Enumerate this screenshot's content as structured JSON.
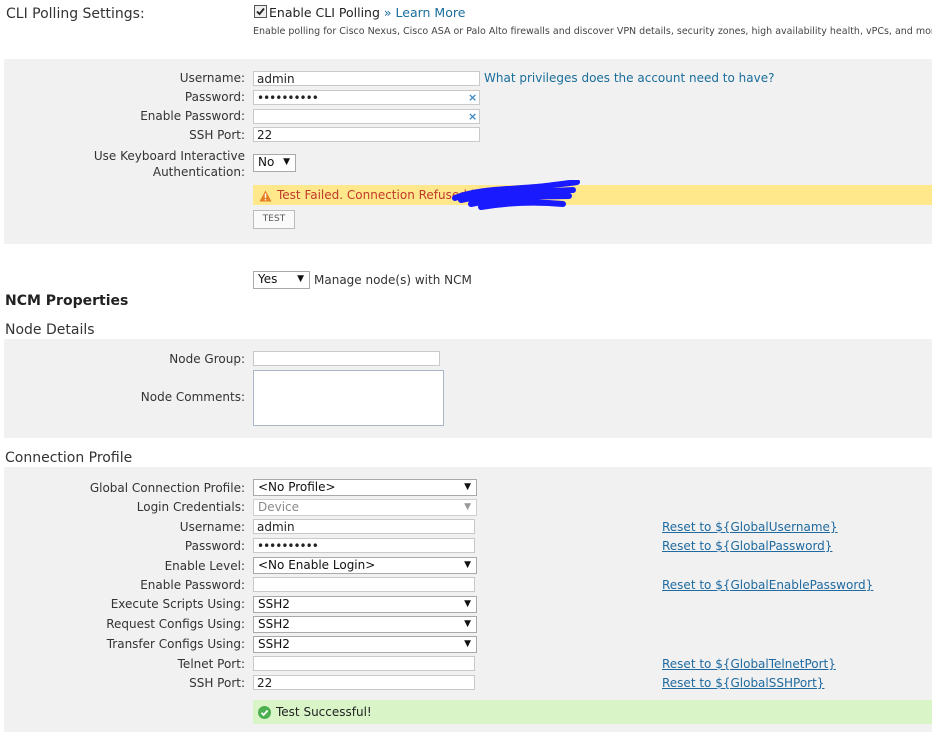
{
  "cli": {
    "section_label": "CLI Polling Settings:",
    "enable_label": "Enable CLI Polling",
    "learn_more": "» Learn More",
    "description": "Enable polling for Cisco Nexus, Cisco ASA or Palo Alto firewalls and discover VPN details, security zones, high availability health, vPCs, and more.",
    "username_label": "Username:",
    "username_value": "admin",
    "privileges_link": "What privileges does the account need to have?",
    "password_label": "Password:",
    "password_value": "••••••••••",
    "enable_password_label": "Enable Password:",
    "ssh_port_label": "SSH Port:",
    "ssh_port_value": "22",
    "kbd_label_line1": "Use Keyboard Interactive",
    "kbd_label_line2": "Authentication:",
    "kbd_value": "No",
    "test_failed": "Test Failed. Connection Refused by",
    "test_button": "TEST",
    "clear_icon": "×"
  },
  "ncm": {
    "manage_value": "Yes",
    "manage_label": "Manage node(s) with NCM",
    "properties_title": "NCM Properties",
    "node_details_title": "Node Details",
    "node_group_label": "Node Group:",
    "node_comments_label": "Node Comments:",
    "connection_profile_title": "Connection Profile",
    "global_profile_label": "Global Connection Profile:",
    "global_profile_value": "<No Profile>",
    "login_credentials_label": "Login Credentials:",
    "login_credentials_value": "Device",
    "username_label": "Username:",
    "username_value": "admin",
    "reset_username": "Reset to ${GlobalUsername}",
    "password_label": "Password:",
    "password_value": "••••••••••",
    "reset_password": "Reset to ${GlobalPassword}",
    "enable_level_label": "Enable Level:",
    "enable_level_value": "<No Enable Login>",
    "enable_password_label": "Enable Password:",
    "reset_enable_password": "Reset to ${GlobalEnablePassword}",
    "execute_scripts_label": "Execute Scripts Using:",
    "execute_scripts_value": "SSH2",
    "request_configs_label": "Request Configs Using:",
    "request_configs_value": "SSH2",
    "transfer_configs_label": "Transfer Configs Using:",
    "transfer_configs_value": "SSH2",
    "telnet_port_label": "Telnet Port:",
    "reset_telnet_port": "Reset to ${GlobalTelnetPort}",
    "ssh_port_label": "SSH Port:",
    "ssh_port_value": "22",
    "reset_ssh_port": "Reset to ${GlobalSSHPort}",
    "test_success": "Test Successful!"
  },
  "colors": {
    "warning_bg": "#ffe88c",
    "warning_text": "#c0392b",
    "success_bg": "#d9f5c8",
    "success_icon": "#4caf50",
    "link": "#1f6aa0",
    "panel_bg": "#f1f1f1"
  },
  "icons": {
    "warning": "warning-triangle-icon",
    "success": "check-circle-icon",
    "clear": "clear-x-icon",
    "dropdown": "dropdown-arrow-icon"
  }
}
